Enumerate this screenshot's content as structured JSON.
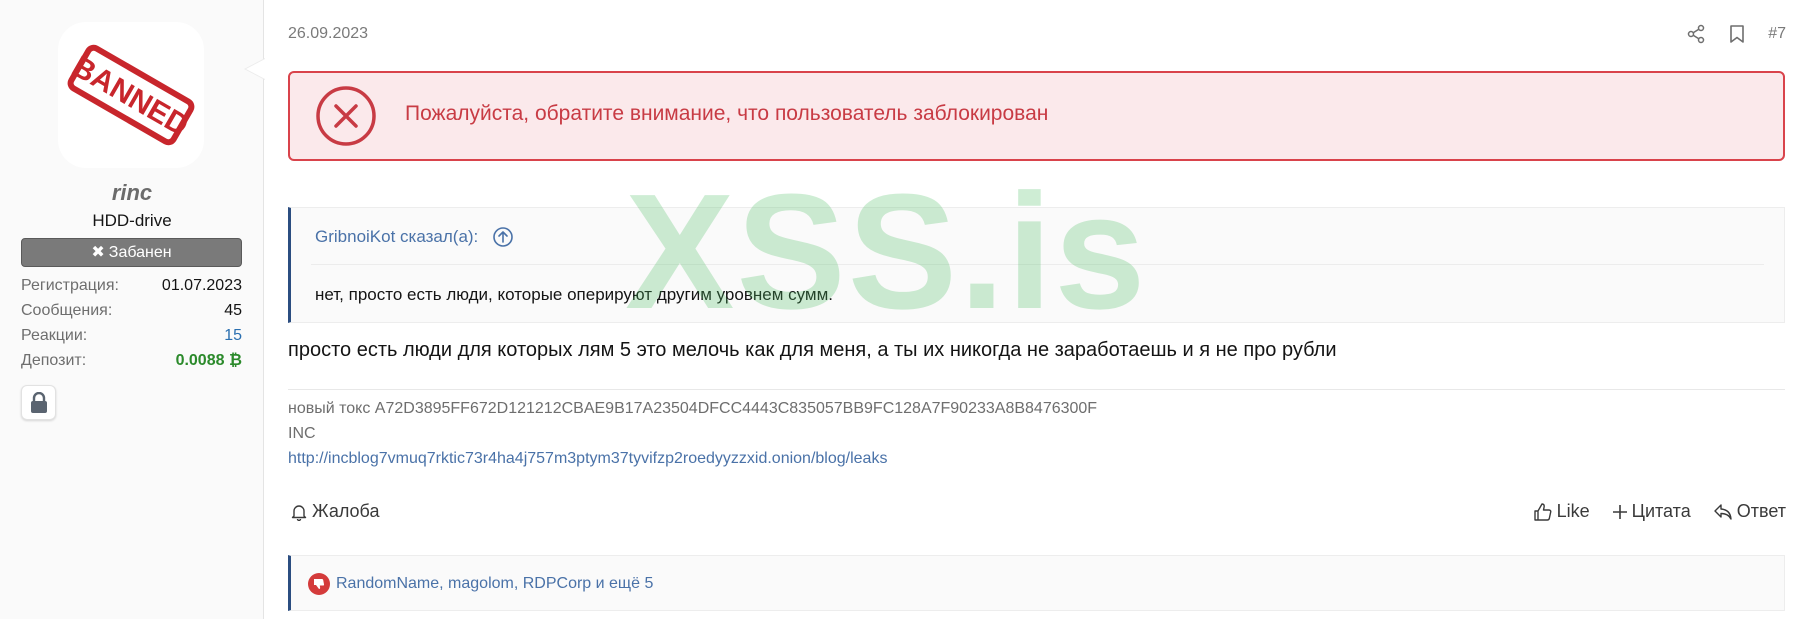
{
  "user": {
    "avatar_stamp": "BANNED",
    "name": "rinc",
    "title": "HDD-drive",
    "banned_label": "Забанен",
    "stats": [
      {
        "label": "Регистрация:",
        "value": "01.07.2023",
        "style": "plain"
      },
      {
        "label": "Сообщения:",
        "value": "45",
        "style": "plain"
      },
      {
        "label": "Реакции:",
        "value": "15",
        "style": "link"
      },
      {
        "label": "Депозит:",
        "value": "0.0088",
        "style": "money"
      }
    ],
    "deposit_currency_symbol": "₿",
    "lock_icon": "lock-icon"
  },
  "post": {
    "date": "26.09.2023",
    "number": "#7",
    "alert": "Пожалуйста, обратите внимание, что пользователь заблокирован",
    "quote": {
      "author": "GribnoiKot сказал(а):",
      "text": "нет, просто есть люди, которые оперируют другим уровнем сумм."
    },
    "message": "просто есть люди для которых лям 5 это мелочь как для меня, а ты их никогда не заработаешь и я не про рубли",
    "signature": {
      "line1": "новый токс A72D3895FF672D121212CBAE9B17A23504DFCC4443C835057BB9FC128A7F90233A8B8476300F",
      "line2": "INC",
      "link": "http://incblog7vmuq7rktic73r4ha4j757m3ptym37tyvifzp2roedyyzzxid.onion/blog/leaks"
    },
    "actions": {
      "report": "Жалоба",
      "like": "Like",
      "quote": "Цитата",
      "reply": "Ответ"
    },
    "reactions": "RandomName, magolom, RDPCorp и ещё 5"
  },
  "watermark": "XSS.is",
  "colors": {
    "alert_border": "#d9434b",
    "alert_bg": "#fbe9eb",
    "link": "#4a72a8",
    "money": "#2b8a2b",
    "quote_bar": "#2b4d80"
  }
}
